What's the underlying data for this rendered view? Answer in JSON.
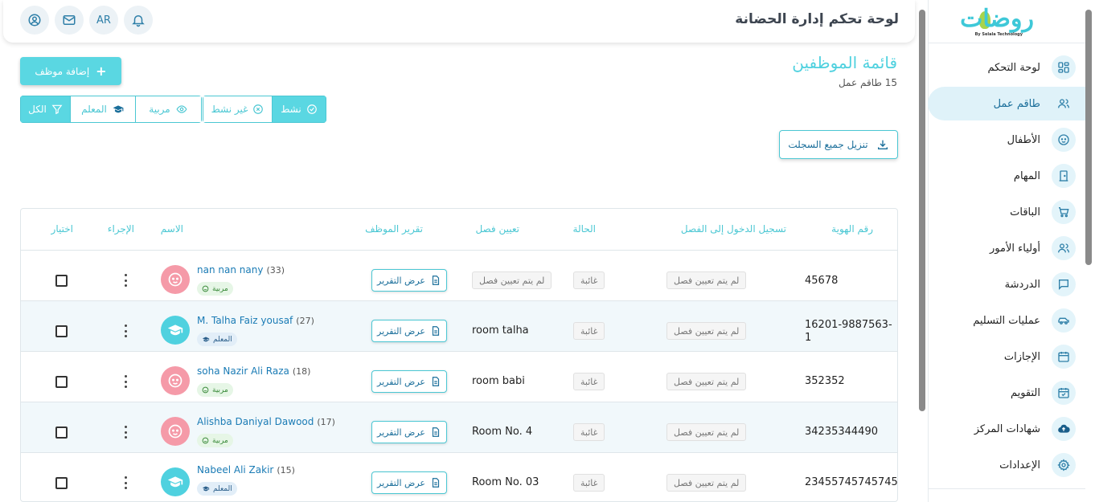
{
  "app": {
    "brand": "روضات",
    "brand_tagline": "By Selala Technology"
  },
  "header": {
    "title": "لوحة تحكم إدارة الحضانة",
    "lang": "AR"
  },
  "sidebar": {
    "items": [
      {
        "label": "لوحة التحكم",
        "icon": "dashboard-icon"
      },
      {
        "label": "طاقم عمل",
        "icon": "users-icon",
        "active": true
      },
      {
        "label": "الأطفال",
        "icon": "baby-face-icon"
      },
      {
        "label": "المهام",
        "icon": "door-icon"
      },
      {
        "label": "الباقات",
        "icon": "cart-icon"
      },
      {
        "label": "أولياء الأمور",
        "icon": "parents-icon"
      },
      {
        "label": "الدردشة",
        "icon": "chat-icon"
      },
      {
        "label": "عمليات التسليم",
        "icon": "car-icon"
      },
      {
        "label": "الإجازات",
        "icon": "calendar-icon"
      },
      {
        "label": "التقويم",
        "icon": "calendar-check-icon"
      },
      {
        "label": "شهادات المركز",
        "icon": "cloud-upload-icon"
      },
      {
        "label": "الإعدادات",
        "icon": "gear-icon"
      }
    ]
  },
  "page": {
    "title": "قائمة الموظفين",
    "subtitle": "15 طاقم عمل",
    "add_button": "إضافة موظف",
    "download_button": "تنزيل جميع السجلت",
    "status_filters": [
      {
        "label": "نشط",
        "active": true
      },
      {
        "label": "غير نشط",
        "active": false
      }
    ],
    "role_filters": [
      {
        "label": "مربية",
        "active": false
      },
      {
        "label": "المعلم",
        "active": false
      },
      {
        "label": "الكل",
        "active": true
      }
    ]
  },
  "table": {
    "headers": {
      "id": "رقم الهوية",
      "checkin": "تسجيل الدخول إلى الفصل",
      "status": "الحالة",
      "class": "تعيين فصل",
      "report": "تقرير الموظف",
      "name": "الاسم",
      "action": "الإجراء",
      "select": "اختيار"
    },
    "report_button": "عرض التقرير",
    "rows": [
      {
        "id": "45678",
        "checkin": "لم يتم تعيين فصل",
        "status": "غائبة",
        "class": "لم يتم تعيين فصل",
        "class_assigned": false,
        "name": "nan nan nany",
        "age": "(33)",
        "role": "مربية",
        "role_type": "nanny"
      },
      {
        "id": "16201-9887563-1",
        "checkin": "لم يتم تعيين فصل",
        "status": "غائبة",
        "class": "room talha",
        "class_assigned": true,
        "name": "M. Talha Faiz yousaf",
        "age": "(27)",
        "role": "المعلم",
        "role_type": "teacher"
      },
      {
        "id": "352352",
        "checkin": "لم يتم تعيين فصل",
        "status": "غائبة",
        "class": "room babi",
        "class_assigned": true,
        "name": "soha Nazir Ali Raza",
        "age": "(18)",
        "role": "مربية",
        "role_type": "nanny"
      },
      {
        "id": "34235344490",
        "checkin": "لم يتم تعيين فصل",
        "status": "غائبة",
        "class": "Room No. 4",
        "class_assigned": true,
        "name": "Alishba Daniyal Dawood",
        "age": "(17)",
        "role": "مربية",
        "role_type": "nanny"
      },
      {
        "id": "23455745745745",
        "checkin": "لم يتم تعيين فصل",
        "status": "غائبة",
        "class": "Room No. 03",
        "class_assigned": true,
        "name": "Nabeel Ali Zakir",
        "age": "(15)",
        "role": "المعلم",
        "role_type": "teacher"
      }
    ]
  },
  "colors": {
    "accent": "#5ad7e2",
    "link": "#1a7bb5",
    "nanny_avatar": "#f59aa8",
    "teacher_avatar": "#4fd1df"
  }
}
